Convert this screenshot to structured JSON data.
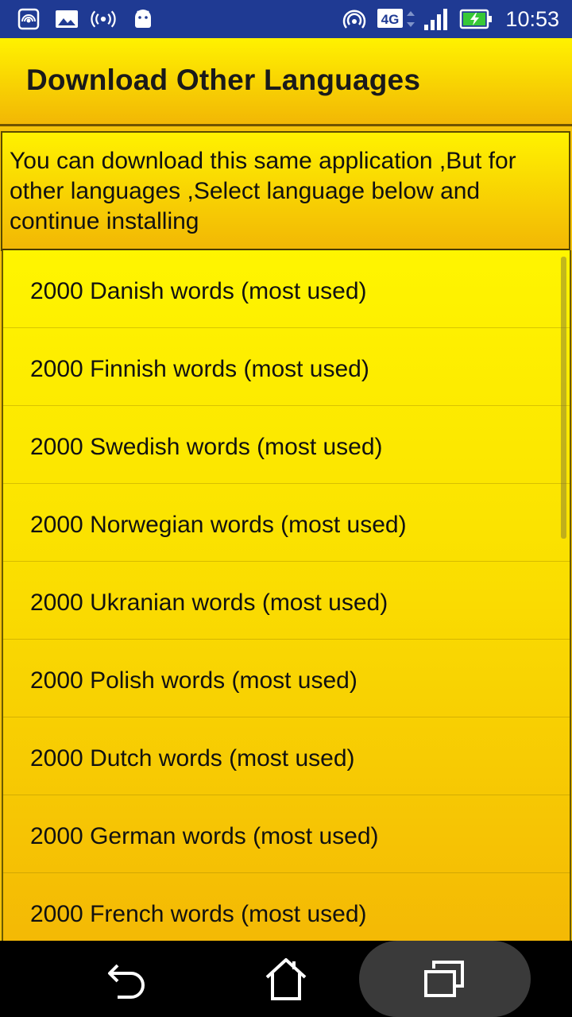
{
  "status_bar": {
    "time": "10:53",
    "network": "4G",
    "icons": [
      "hotspot-icon",
      "image-icon",
      "broadcast-icon",
      "android-icon",
      "wifi-hotspot-icon",
      "network-4g-icon",
      "signal-icon",
      "battery-charging-icon"
    ]
  },
  "header": {
    "title": "Download Other Languages"
  },
  "description": "You can download this same application ,But for other languages ,Select language below and continue installing",
  "languages": [
    "2000 Danish words (most used)",
    "2000 Finnish words (most used)",
    "2000 Swedish words (most used)",
    "2000 Norwegian words (most used)",
    "2000 Ukranian words (most used)",
    "2000 Polish words (most used)",
    "2000 Dutch words (most used)",
    "2000 German words (most used)",
    "2000 French words (most used)"
  ],
  "navbar": {
    "buttons": [
      "back-icon",
      "home-icon",
      "recents-icon"
    ]
  },
  "colors": {
    "status_bar": "#1f3a93",
    "accent_yellow": "#fff200",
    "accent_orange": "#f2b705"
  }
}
